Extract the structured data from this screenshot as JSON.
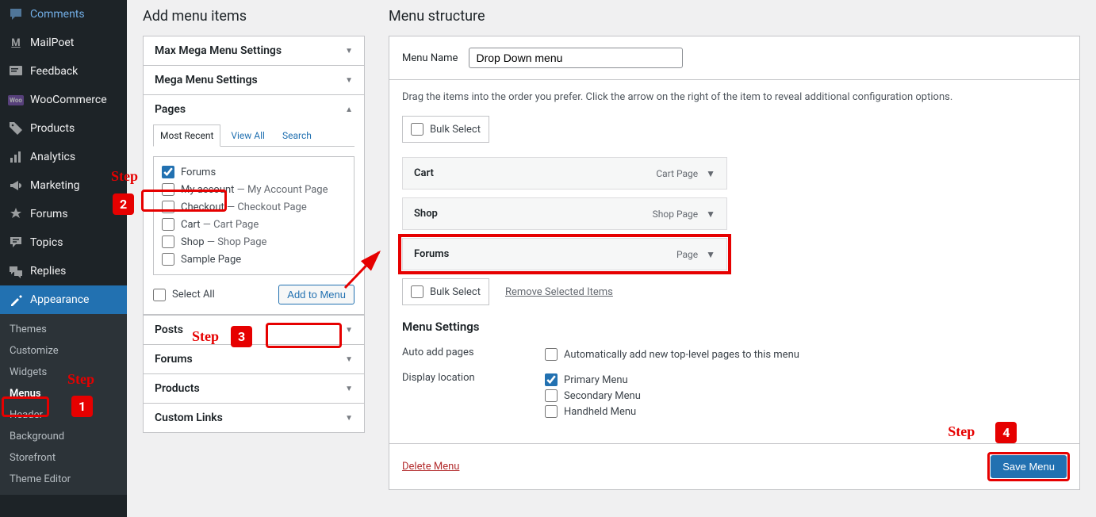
{
  "sidebar": {
    "items": [
      {
        "label": "Comments",
        "icon": "comment"
      },
      {
        "label": "MailPoet",
        "icon": "mailpoet"
      },
      {
        "label": "Feedback",
        "icon": "feedback"
      },
      {
        "label": "WooCommerce",
        "icon": "woo"
      },
      {
        "label": "Products",
        "icon": "products"
      },
      {
        "label": "Analytics",
        "icon": "analytics"
      },
      {
        "label": "Marketing",
        "icon": "marketing"
      },
      {
        "label": "Forums",
        "icon": "forums"
      },
      {
        "label": "Topics",
        "icon": "topics"
      },
      {
        "label": "Replies",
        "icon": "replies"
      },
      {
        "label": "Appearance",
        "icon": "appearance",
        "active": true
      }
    ],
    "subs": [
      {
        "label": "Themes"
      },
      {
        "label": "Customize"
      },
      {
        "label": "Widgets"
      },
      {
        "label": "Menus",
        "active": true
      },
      {
        "label": "Header"
      },
      {
        "label": "Background"
      },
      {
        "label": "Storefront"
      },
      {
        "label": "Theme Editor"
      }
    ]
  },
  "left": {
    "heading": "Add menu items",
    "panels": [
      {
        "title": "Max Mega Menu Settings",
        "open": false
      },
      {
        "title": "Mega Menu Settings",
        "open": false
      }
    ],
    "pages": {
      "title": "Pages",
      "tabs": [
        "Most Recent",
        "View All",
        "Search"
      ],
      "items": [
        {
          "label": "Forums",
          "checked": true,
          "suffix": ""
        },
        {
          "label": "My account",
          "checked": false,
          "suffix": " — My Account Page"
        },
        {
          "label": "Checkout",
          "checked": false,
          "suffix": " — Checkout Page"
        },
        {
          "label": "Cart",
          "checked": false,
          "suffix": " — Cart Page"
        },
        {
          "label": "Shop",
          "checked": false,
          "suffix": " — Shop Page"
        },
        {
          "label": "Sample Page",
          "checked": false,
          "suffix": ""
        }
      ],
      "select_all": "Select All",
      "add_btn": "Add to Menu"
    },
    "more_panels": [
      {
        "title": "Posts"
      },
      {
        "title": "Forums"
      },
      {
        "title": "Products"
      },
      {
        "title": "Custom Links"
      }
    ]
  },
  "right": {
    "heading": "Menu structure",
    "name_label": "Menu Name",
    "name_value": "Drop Down menu",
    "hint": "Drag the items into the order you prefer. Click the arrow on the right of the item to reveal additional configuration options.",
    "bulk": "Bulk Select",
    "items": [
      {
        "label": "Cart",
        "type": "Cart Page"
      },
      {
        "label": "Shop",
        "type": "Shop Page"
      },
      {
        "label": "Forums",
        "type": "Page",
        "highlight": true
      }
    ],
    "remove": "Remove Selected Items",
    "settings_h": "Menu Settings",
    "settings": {
      "auto_label": "Auto add pages",
      "auto_opt": "Automatically add new top-level pages to this menu",
      "loc_label": "Display location",
      "locs": [
        {
          "label": "Primary Menu",
          "checked": true
        },
        {
          "label": "Secondary Menu",
          "checked": false
        },
        {
          "label": "Handheld Menu",
          "checked": false
        }
      ]
    },
    "delete": "Delete Menu",
    "save": "Save Menu"
  },
  "steps": {
    "label": "Step",
    "n1": "1",
    "n2": "2",
    "n3": "3",
    "n4": "4"
  }
}
